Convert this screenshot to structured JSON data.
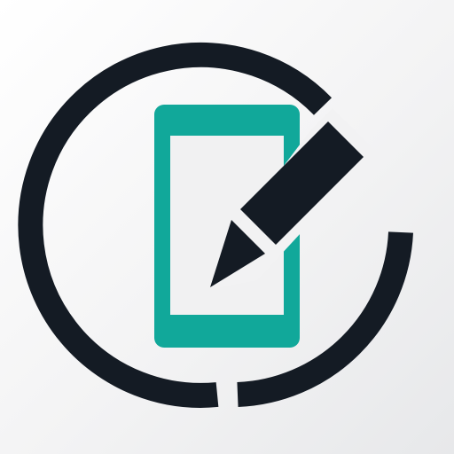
{
  "colors": {
    "background_light": "#ffffff",
    "background_shade": "#e7e8ea",
    "ring": "#141b24",
    "phone": "#11a89a",
    "screen": "#f1f1f2",
    "pencil": "#141b24"
  },
  "icons": {
    "logo": "phone-edit-logo-icon",
    "phone": "smartphone-icon",
    "pencil": "pencil-icon",
    "ring": "broken-circle-icon"
  }
}
